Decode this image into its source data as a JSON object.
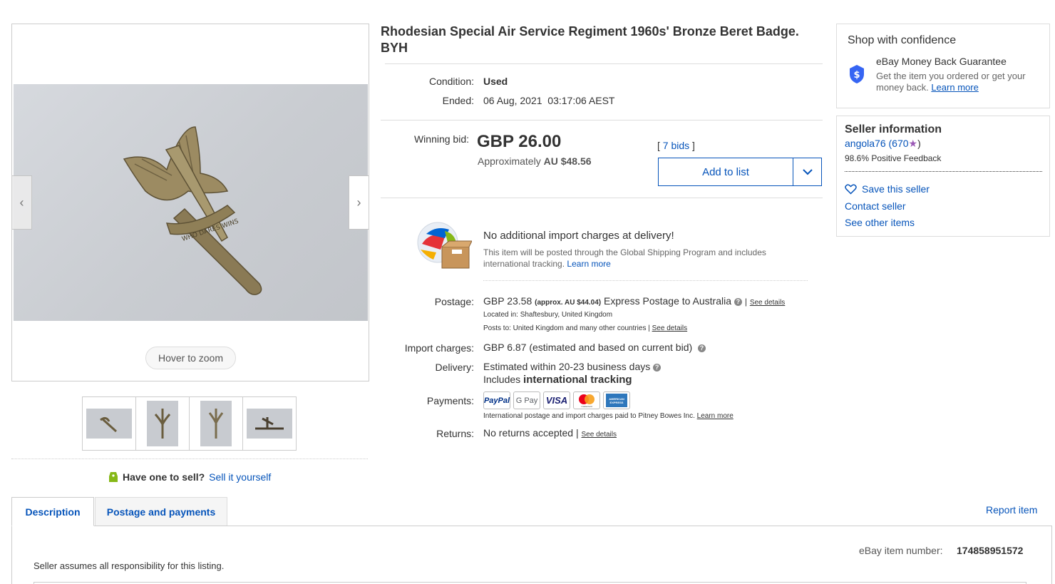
{
  "listing": {
    "title": "Rhodesian Special Air Service Regiment 1960s' Bronze Beret Badge. BYH",
    "condition_label": "Condition:",
    "condition_value": "Used",
    "ended_label": "Ended:",
    "ended_value": "06 Aug, 2021  03:17:06 AEST"
  },
  "gallery": {
    "zoom_label": "Hover to zoom",
    "badge_motto": "WHO DARES WINS",
    "prev_icon": "chevron-left-icon",
    "next_icon": "chevron-right-icon",
    "thumbnail_count": 4
  },
  "sell": {
    "question": "Have one to sell?",
    "link": "Sell it yourself"
  },
  "bid": {
    "label": "Winning bid:",
    "price": "GBP 26.00",
    "approx_prefix": "Approximately",
    "approx_value": "AU $48.56",
    "bids_open": "[",
    "bids_link": "7 bids",
    "bids_close": "]",
    "add_to_list": "Add to list"
  },
  "import_notice": {
    "heading": "No additional import charges at delivery!",
    "body": "This item will be posted through the Global Shipping Program and includes international tracking.",
    "learn_more": "Learn more"
  },
  "postage": {
    "label": "Postage:",
    "price": "GBP 23.58",
    "approx": "(approx. AU $44.04)",
    "service": "Express Postage to Australia",
    "sep": "|",
    "see_details": "See details",
    "located_in": "Located in:  Shaftesbury, United Kingdom",
    "posts_to": "Posts to:  United Kingdom and many other countries |",
    "posts_to_link": "See details"
  },
  "import_charges": {
    "label": "Import charges:",
    "value": "GBP 6.87",
    "note": "(estimated and based on current bid)"
  },
  "delivery": {
    "label": "Delivery:",
    "estimate": "Estimated within 20-23 business days",
    "includes": "Includes",
    "tracking": "international tracking"
  },
  "payments": {
    "label": "Payments:",
    "methods": [
      "PayPal",
      "G Pay",
      "VISA",
      "mastercard",
      "AMERICAN EXPRESS"
    ],
    "note": "International postage and import charges paid to Pitney Bowes Inc.",
    "learn_more": "Learn more"
  },
  "returns": {
    "label": "Returns:",
    "value": "No returns accepted |",
    "see_details": "See details"
  },
  "confidence": {
    "title": "Shop with confidence",
    "guarantee_title": "eBay Money Back Guarantee",
    "guarantee_body": "Get the item you ordered or get your money back.",
    "learn_more": "Learn more"
  },
  "seller": {
    "title": "Seller information",
    "name": "angola76",
    "score_open": "(670",
    "score_close": ")",
    "feedback": "98.6% Positive Feedback",
    "save": "Save this seller",
    "contact": "Contact seller",
    "other_items": "See other items"
  },
  "tabs": {
    "description": "Description",
    "postage": "Postage and payments",
    "report": "Report item"
  },
  "description": {
    "item_number_label": "eBay item number:",
    "item_number": "174858951572",
    "responsibility": "Seller assumes all responsibility for this listing."
  },
  "colors": {
    "link": "#0654ba",
    "shield": "#3665f3",
    "star": "#9b59b6"
  }
}
